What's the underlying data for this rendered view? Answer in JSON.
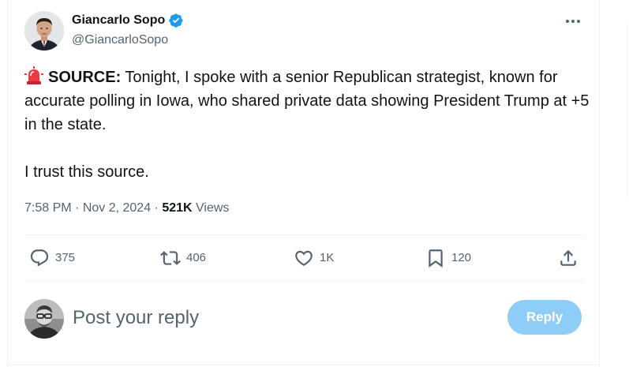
{
  "author": {
    "display_name": "Giancarlo Sopo",
    "handle": "@GiancarloSopo",
    "verified_icon": "verified-badge-icon",
    "avatar": "avatar-photo"
  },
  "tweet": {
    "emoji_icon": "rotating-light-icon",
    "lead_bold": "SOURCE:",
    "paragraph1_rest": " Tonight, I spoke with a senior Republican strategist, known for accurate polling in Iowa, who shared private data showing President Trump at +5 in the state.",
    "paragraph2": "I trust this source."
  },
  "meta": {
    "time": "7:58 PM",
    "sep1": " · ",
    "date": "Nov 2, 2024",
    "sep2": " · ",
    "views_count": "521K",
    "views_label": " Views"
  },
  "actions": {
    "reply_count": "375",
    "repost_count": "406",
    "like_count": "1K",
    "bookmark_count": "120"
  },
  "reply_box": {
    "placeholder": "Post your reply",
    "button_label": "Reply"
  },
  "colors": {
    "text_primary": "#0f1419",
    "text_secondary": "#536471",
    "verified_blue": "#1d9bf0",
    "reply_button_disabled": "#8ecdf8",
    "border": "#eff3f4"
  }
}
